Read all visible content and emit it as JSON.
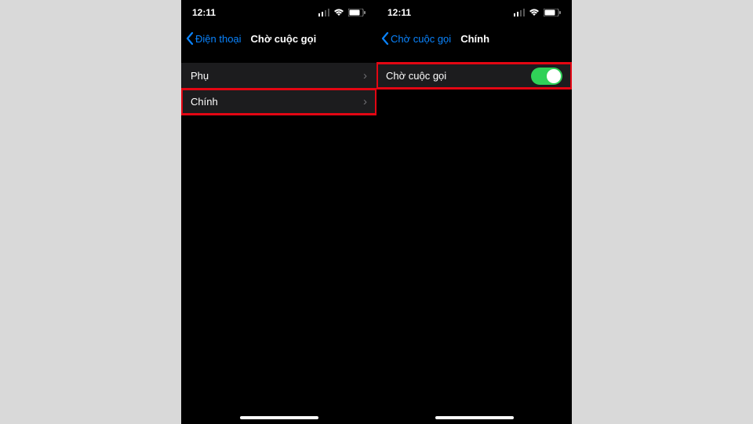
{
  "phone_left": {
    "time": "12:11",
    "back_label": "Điện thoại",
    "title": "Chờ cuộc gọi",
    "items": [
      {
        "label": "Phụ"
      },
      {
        "label": "Chính"
      }
    ]
  },
  "phone_right": {
    "time": "12:11",
    "back_label": "Chờ cuộc gọi",
    "title": "Chính",
    "toggle_label": "Chờ cuộc gọi"
  }
}
